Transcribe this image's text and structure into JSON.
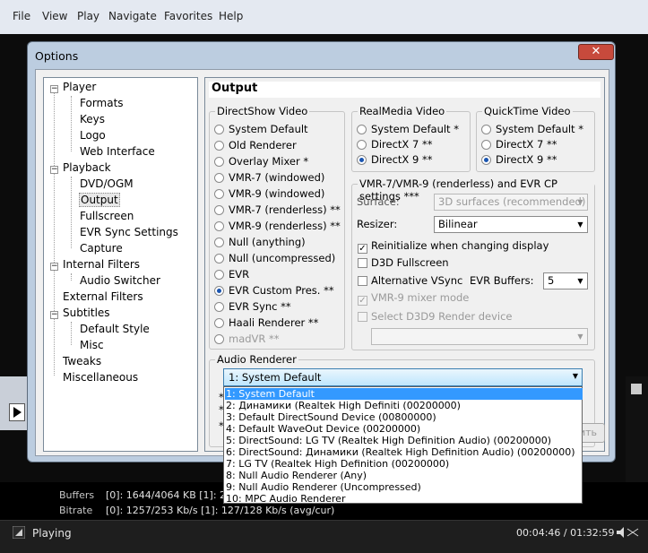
{
  "menubar": [
    "File",
    "View",
    "Play",
    "Navigate",
    "Favorites",
    "Help"
  ],
  "stats": {
    "buffers_label": "Buffers",
    "buffers_value": "[0]: 1644/4064 KB [1]: 2816",
    "bitrate_label": "Bitrate",
    "bitrate_value": "[0]: 1257/253 Kb/s [1]: 127/128 Kb/s (avg/cur)"
  },
  "status": {
    "text": "Playing",
    "time": "00:04:46 / 01:32:59"
  },
  "dialog": {
    "title": "Options",
    "close": "✕"
  },
  "tree": {
    "player": "Player",
    "formats": "Formats",
    "keys": "Keys",
    "logo": "Logo",
    "web_interface": "Web Interface",
    "playback": "Playback",
    "dvd_ogm": "DVD/OGM",
    "output": "Output",
    "fullscreen": "Fullscreen",
    "evr_sync": "EVR Sync Settings",
    "capture": "Capture",
    "internal_filters": "Internal Filters",
    "audio_switcher": "Audio Switcher",
    "external_filters": "External Filters",
    "subtitles": "Subtitles",
    "default_style": "Default Style",
    "misc": "Misc",
    "tweaks": "Tweaks",
    "miscellaneous": "Miscellaneous"
  },
  "panel": {
    "heading": "Output",
    "directshow": {
      "title": "DirectShow Video",
      "options": [
        "System Default",
        "Old Renderer",
        "Overlay Mixer *",
        "VMR-7 (windowed)",
        "VMR-9 (windowed)",
        "VMR-7 (renderless) **",
        "VMR-9 (renderless) **",
        "Null (anything)",
        "Null (uncompressed)",
        "EVR",
        "EVR Custom Pres. **",
        "EVR Sync **",
        "Haali Renderer **",
        "madVR **"
      ],
      "selected": 10
    },
    "realmedia": {
      "title": "RealMedia Video",
      "options": [
        "System Default *",
        "DirectX 7 **",
        "DirectX 9 **"
      ],
      "selected": 2
    },
    "quicktime": {
      "title": "QuickTime Video",
      "options": [
        "System Default *",
        "DirectX 7 **",
        "DirectX 9 **"
      ],
      "selected": 2
    },
    "vmr": {
      "title": "VMR-7/VMR-9 (renderless) and EVR CP settings ***",
      "surface_label": "Surface:",
      "surface_value": "3D surfaces (recommended) **",
      "resizer_label": "Resizer:",
      "resizer_value": "Bilinear",
      "reinit": "Reinitialize when changing display",
      "d3d_fullscreen": "D3D Fullscreen",
      "alt_vsync": "Alternative VSync",
      "evr_buffers_label": "EVR Buffers:",
      "evr_buffers_value": "5",
      "vmr9_mixer": "VMR-9 mixer mode",
      "select_d3d9": "Select D3D9 Render device",
      "device_value": ""
    },
    "audio": {
      "title": "Audio Renderer",
      "selected": "1: System Default",
      "options": [
        "1: System Default",
        "2: Динамики (Realtek High Definiti (00200000)",
        "3: Default DirectSound Device (00800000)",
        "4: Default WaveOut Device (00200000)",
        "5: DirectSound: LG TV (Realtek High Definition Audio) (00200000)",
        "6: DirectSound: Динамики (Realtek High Definition Audio) (00200000)",
        "7: LG TV (Realtek High Definition  (00200000)",
        "8: Null Audio Renderer (Any)",
        "9: Null Audio Renderer (Uncompressed)",
        "10: MPC Audio Renderer"
      ]
    },
    "asterisks": [
      "*",
      "*",
      "*"
    ],
    "apply_fragment": "ить"
  },
  "colors": {
    "accent": "#3399ff",
    "title_bar": "#bccde0",
    "close": "#c74a3c"
  }
}
